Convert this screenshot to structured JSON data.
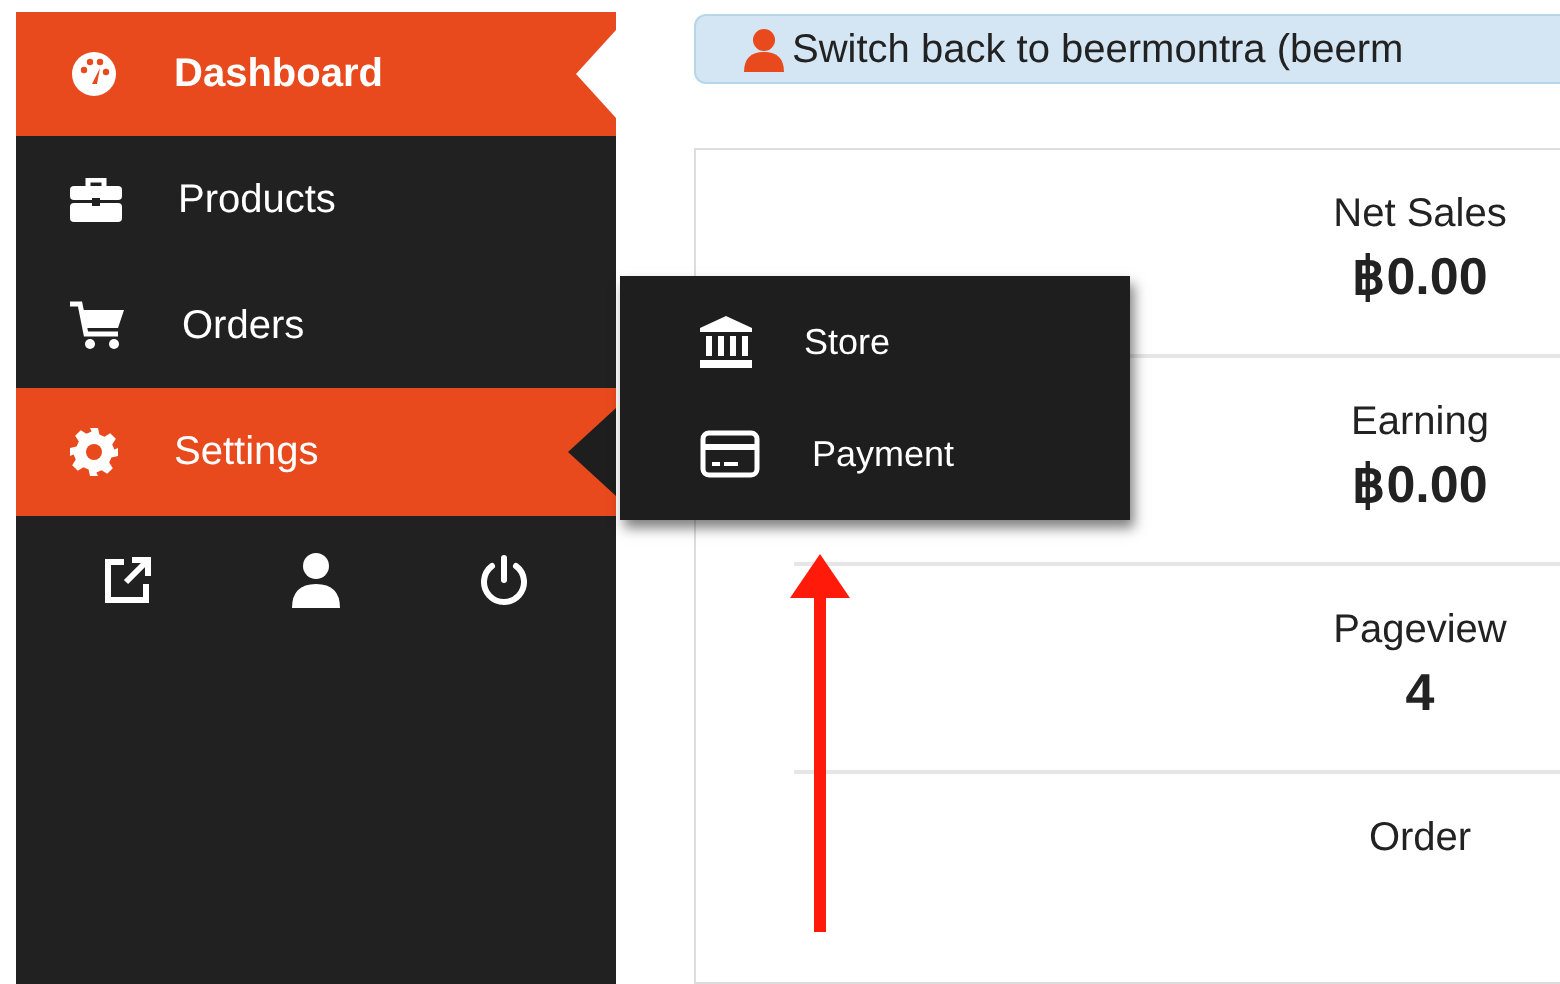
{
  "sidebar": {
    "items": [
      {
        "label": "Dashboard",
        "selected": true,
        "expanded": false
      },
      {
        "label": "Products",
        "selected": false,
        "expanded": false
      },
      {
        "label": "Orders",
        "selected": false,
        "expanded": false
      },
      {
        "label": "Settings",
        "selected": false,
        "expanded": true,
        "submenu": [
          {
            "label": "Store"
          },
          {
            "label": "Payment"
          }
        ]
      }
    ]
  },
  "notice": {
    "text": "Switch back to beermontra (beerm"
  },
  "stats": [
    {
      "label": "Net Sales",
      "value": "฿0.00"
    },
    {
      "label": "Earning",
      "value": "฿0.00"
    },
    {
      "label": "Pageview",
      "value": "4"
    },
    {
      "label": "Order"
    }
  ]
}
